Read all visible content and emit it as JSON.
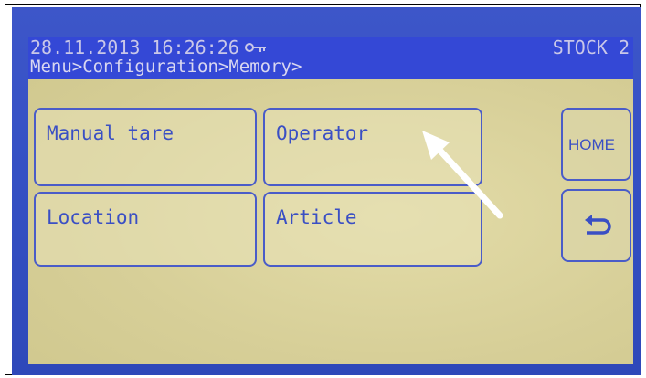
{
  "status_bar": {
    "datetime": "28.11.2013 16:26:26",
    "key_icon": "key-icon",
    "mode": "STOCK 2"
  },
  "breadcrumb": "Menu>Configuration>Memory>",
  "buttons": {
    "manual_tare": "Manual tare",
    "operator": "Operator",
    "location": "Location",
    "article": "Article",
    "home": "HOME",
    "back_icon": "back-arrow-icon"
  },
  "colors": {
    "bezel": "#3450c4",
    "screen": "#d9d19b",
    "status_bar": "#3448d6",
    "button_text": "#3a4fc4",
    "pointer_arrow": "#ffffff"
  }
}
